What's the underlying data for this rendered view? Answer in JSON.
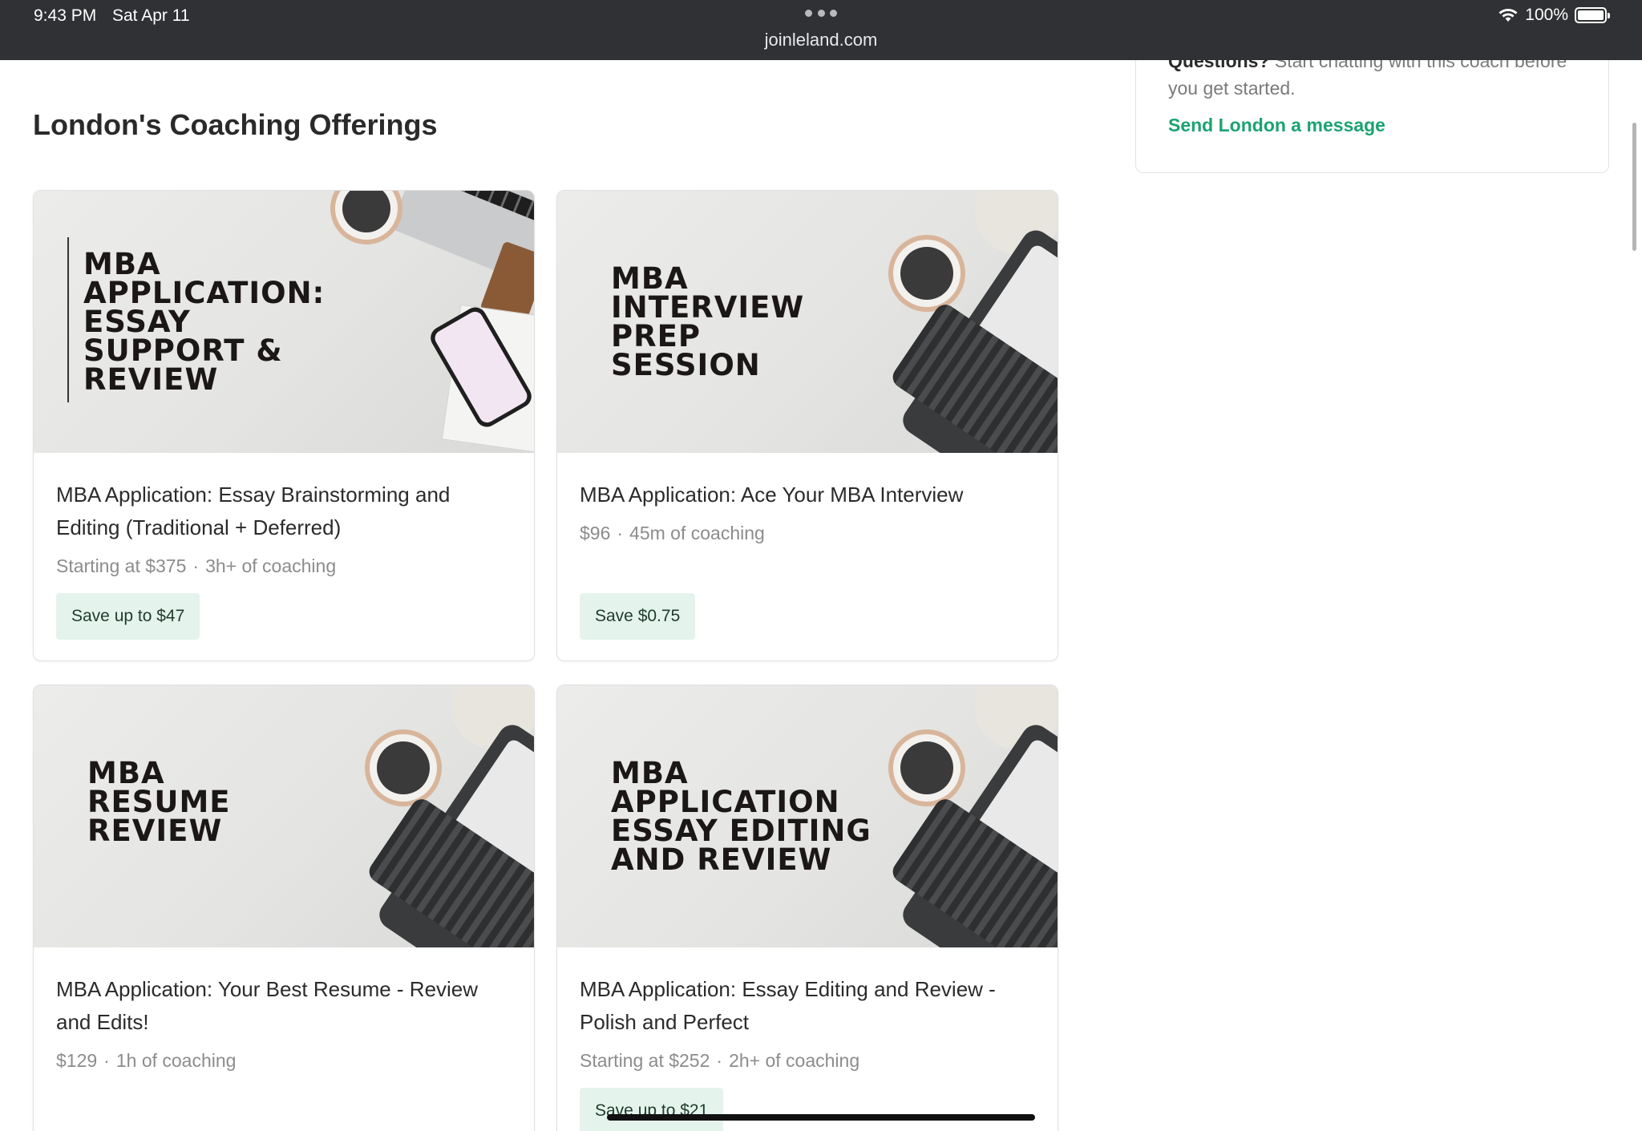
{
  "status_bar": {
    "time": "9:43 PM",
    "date": "Sat Apr 11",
    "url": "joinleland.com",
    "battery": "100%",
    "icons": [
      "more-dots-icon",
      "wifi-icon",
      "battery-icon"
    ]
  },
  "sidebar": {
    "question_bold": "Questions?",
    "question_text": "Start chatting with this coach before you get started.",
    "message_link": "Send London a message"
  },
  "section_title": "London's Coaching Offerings",
  "offerings": [
    {
      "image_heading": [
        "MBA",
        "APPLICATION:",
        "ESSAY",
        "SUPPORT &",
        "REVIEW"
      ],
      "title": "MBA Application: Essay Brainstorming and Editing (Traditional + Deferred)",
      "price": "Starting at $375",
      "duration": "3h+ of coaching",
      "save": "Save up to $47"
    },
    {
      "image_heading": [
        "MBA",
        "INTERVIEW",
        "PREP",
        "SESSION"
      ],
      "title": "MBA Application: Ace Your MBA Interview",
      "price": "$96",
      "duration": "45m of coaching",
      "save": "Save $0.75"
    },
    {
      "image_heading": [
        "MBA",
        "RESUME",
        "REVIEW"
      ],
      "title": "MBA Application: Your Best Resume - Review and Edits!",
      "price": "$129",
      "duration": "1h of coaching",
      "save": ""
    },
    {
      "image_heading": [
        "MBA",
        "APPLICATION",
        "ESSAY EDITING",
        "AND REVIEW"
      ],
      "title": "MBA Application: Essay Editing and Review - Polish and Perfect",
      "price": "Starting at $252",
      "duration": "2h+ of coaching",
      "save": "Save up to $21"
    }
  ],
  "colors": {
    "accent_green": "#1aa371",
    "save_badge_bg": "#e4f4ec",
    "status_bar_bg": "#2f3134"
  }
}
